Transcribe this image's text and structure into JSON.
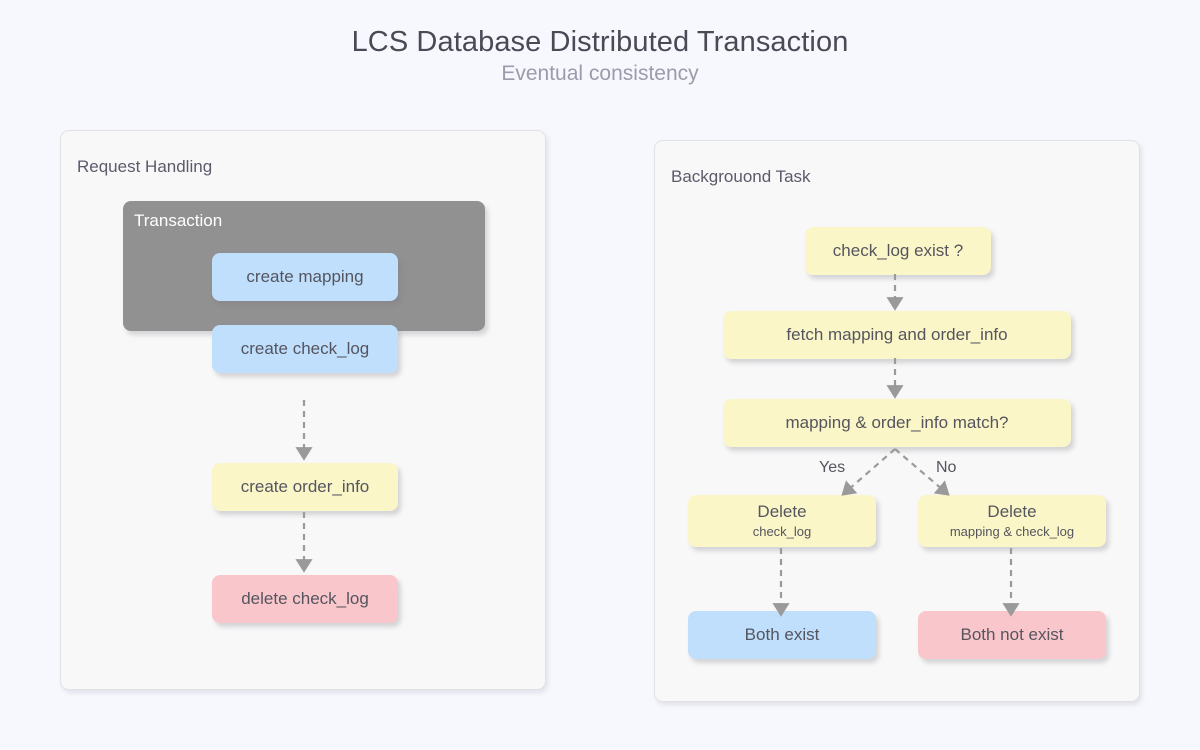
{
  "header": {
    "title": "LCS Database Distributed Transaction",
    "subtitle": "Eventual consistency"
  },
  "colors": {
    "page_background": "#f7f8fd",
    "panel_background": "#f8f8f8",
    "group_gray": "#919191",
    "node_blue": "#bfdffc",
    "node_yellow": "#fbf6c8",
    "node_pink": "#f9c7cb",
    "text": "#55555f",
    "arrow": "#9a9a9a"
  },
  "panels": {
    "left": {
      "title": "Request Handling",
      "group": {
        "title": "Transaction"
      },
      "nodes": {
        "create_mapping": "create mapping",
        "create_check_log": "create check_log",
        "create_order_info": "create order_info",
        "delete_check_log": "delete check_log"
      }
    },
    "right": {
      "title": "Backgrouond Task",
      "nodes": {
        "check_log_exist": "check_log exist ?",
        "fetch": "fetch mapping and order_info",
        "match": "mapping & order_info match?",
        "delete_yes_title": "Delete",
        "delete_yes_sub": "check_log",
        "delete_no_title": "Delete",
        "delete_no_sub": "mapping & check_log",
        "both_exist": "Both exist",
        "both_not_exist": "Both not exist"
      },
      "edge_labels": {
        "yes": "Yes",
        "no": "No"
      }
    }
  }
}
